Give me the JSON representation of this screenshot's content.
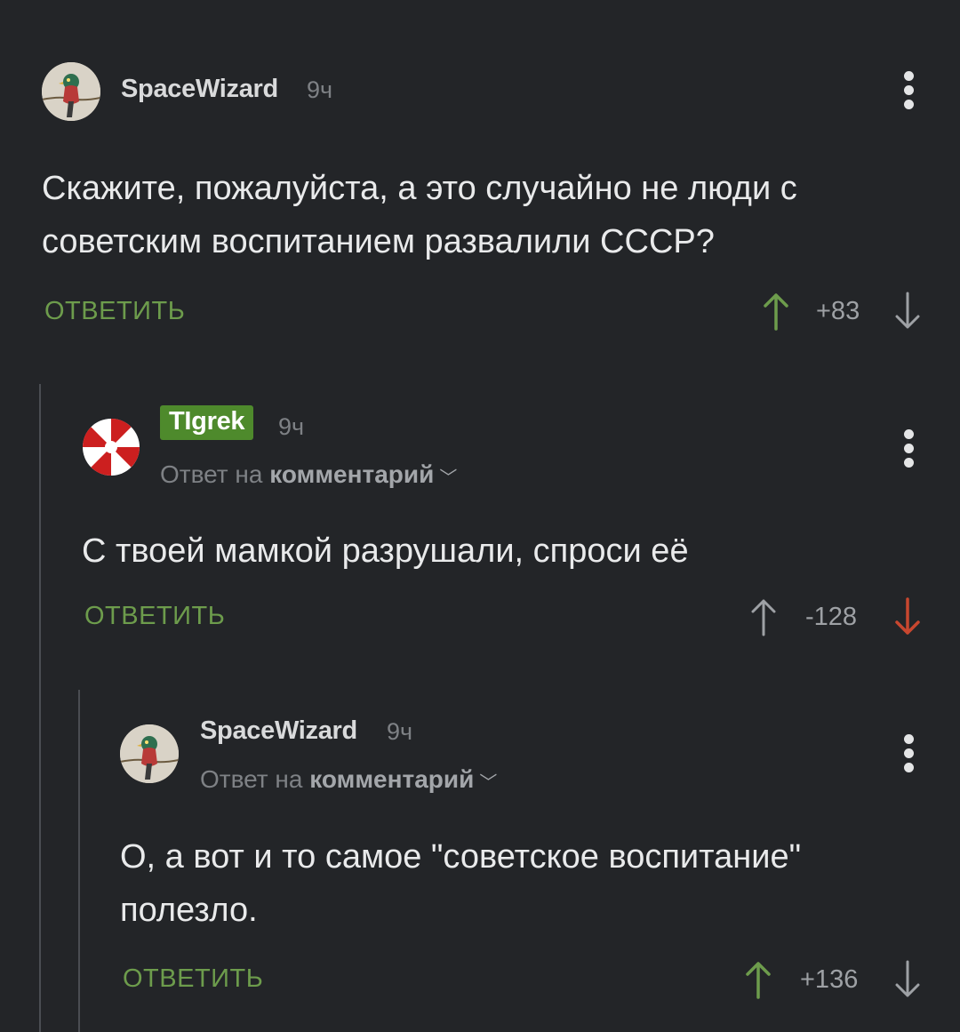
{
  "colors": {
    "background": "#232528",
    "accent_green": "#6d9c4c",
    "badge_green": "#4e8a2c",
    "downvote_red": "#c8472f",
    "muted": "#7e8185"
  },
  "comments": [
    {
      "author": "SpaceWizard",
      "time": "9ч",
      "text": "Скажите, пожалуйста, а это случайно не люди с советским воспитанием развалили СССР?",
      "reply_label": "ОТВЕТИТЬ",
      "score": "+83",
      "vote_state": "upvoted",
      "avatar_icon": "bird-avatar-icon"
    },
    {
      "author": "TIgrek",
      "time": "9ч",
      "reply_prefix": "Ответ на",
      "reply_target": "комментарий",
      "text": "С твоей мамкой разрушали, спроси её",
      "reply_label": "ОТВЕТИТЬ",
      "score": "-128",
      "vote_state": "downvoted",
      "avatar_icon": "umbrella-logo-icon"
    },
    {
      "author": "SpaceWizard",
      "time": "9ч",
      "reply_prefix": "Ответ на",
      "reply_target": "комментарий",
      "text": "О, а вот и то самое \"советское воспитание\" полезло.",
      "reply_label": "ОТВЕТИТЬ",
      "score": "+136",
      "vote_state": "upvoted",
      "avatar_icon": "bird-avatar-icon"
    }
  ]
}
